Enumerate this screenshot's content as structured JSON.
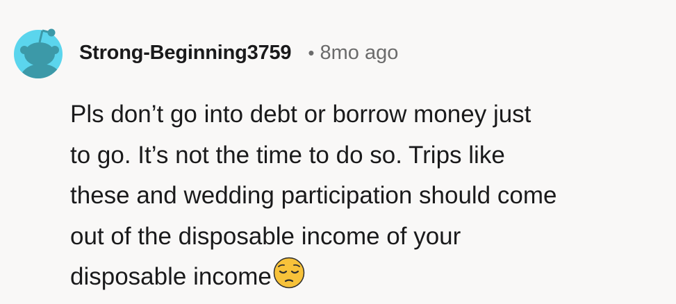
{
  "comment": {
    "author": "Strong-Beginning3759",
    "separator": "•",
    "age": "8mo ago",
    "body_lines": [
      "Pls don’t go into debt or borrow money just",
      "to go. It’s not the time to do so. Trips like",
      "these and wedding participation should come",
      "out of the disposable income of your",
      "disposable income"
    ],
    "trailing_emoji": "pensive-face-icon",
    "avatar_icon": "snoo-avatar-icon"
  },
  "colors": {
    "background": "#f9f8f7",
    "avatar_background": "#5bd5ed",
    "avatar_figure": "#3c99a8",
    "text": "#1a1a1b",
    "muted": "#6b6b6b",
    "emoji_yellow": "#f7c23a"
  }
}
